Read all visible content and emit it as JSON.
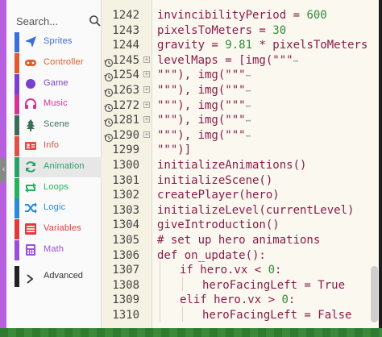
{
  "sidebar": {
    "search": {
      "placeholder": "Search...",
      "icon": "search-icon"
    },
    "categories": [
      {
        "label": "Sprites",
        "color": "#3d6fd8",
        "icon": "send-icon"
      },
      {
        "label": "Controller",
        "color": "#e05a2b",
        "icon": "gamepad-icon"
      },
      {
        "label": "Game",
        "color": "#7b3fd0",
        "icon": "circle-icon"
      },
      {
        "label": "Music",
        "color": "#d0359a",
        "icon": "headphones-icon"
      },
      {
        "label": "Scene",
        "color": "#3b6e5a",
        "icon": "tree-icon"
      },
      {
        "label": "Info",
        "color": "#e0504a",
        "icon": "id-card-icon"
      },
      {
        "label": "Animation",
        "color": "#2aa06a",
        "icon": "refresh-icon",
        "selected": true
      },
      {
        "label": "Loops",
        "color": "#24b35a",
        "icon": "loop-icon"
      },
      {
        "label": "Logic",
        "color": "#2b8ad8",
        "icon": "shuffle-icon"
      },
      {
        "label": "Variables",
        "color": "#e03b3b",
        "icon": "list-icon"
      },
      {
        "label": "Math",
        "color": "#9a4fd8",
        "icon": "calculator-icon"
      }
    ],
    "advanced": {
      "label": "Advanced",
      "color": "#222222",
      "icon": "chevron-right-icon"
    }
  },
  "editor": {
    "lines": [
      {
        "n": "1242",
        "code": "invincibilityPeriod = 600"
      },
      {
        "n": "1243",
        "code": "pixelsToMeters = 30"
      },
      {
        "n": "1244",
        "code": "gravity = 9.81 * pixelsToMeters"
      },
      {
        "n": "1245",
        "code": "levelMaps = [img(\"\"\"",
        "folded": true,
        "history": true
      },
      {
        "n": "1254",
        "code": "\"\"\"), img(\"\"\"",
        "folded": true,
        "history": true
      },
      {
        "n": "1263",
        "code": "\"\"\"), img(\"\"\"",
        "folded": true,
        "history": true
      },
      {
        "n": "1272",
        "code": "\"\"\"), img(\"\"\"",
        "folded": true,
        "history": true
      },
      {
        "n": "1281",
        "code": "\"\"\"), img(\"\"\"",
        "folded": true,
        "history": true
      },
      {
        "n": "1290",
        "code": "\"\"\"), img(\"\"\"",
        "folded": true,
        "history": true
      },
      {
        "n": "1299",
        "code": "\"\"\")]"
      },
      {
        "n": "1300",
        "code": "initializeAnimations()"
      },
      {
        "n": "1301",
        "code": "initializeScene()"
      },
      {
        "n": "1302",
        "code": "createPlayer(hero)"
      },
      {
        "n": "1303",
        "code": "initializeLevel(currentLevel)"
      },
      {
        "n": "1304",
        "code": "giveIntroduction()"
      },
      {
        "n": "1305",
        "code": "# set up hero animations"
      },
      {
        "n": "1306",
        "code": "def on_update():"
      },
      {
        "n": "1307",
        "code": "if hero.vx < 0:",
        "indent": 1
      },
      {
        "n": "1308",
        "code": "heroFacingLeft = True",
        "indent": 2
      },
      {
        "n": "1309",
        "code": "elif hero.vx > 0:",
        "indent": 1
      },
      {
        "n": "1310",
        "code": "heroFacingLeft = False",
        "indent": 2
      }
    ],
    "fold_marker": "⋯"
  }
}
